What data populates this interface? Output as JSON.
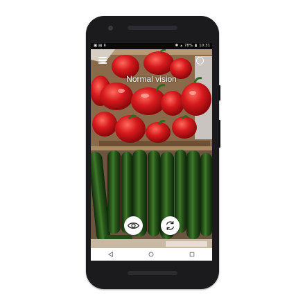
{
  "status_bar": {
    "battery": "78%",
    "time": "10:31"
  },
  "app": {
    "mode_title": "Normal vision"
  },
  "icons": {
    "menu": "hamburger-menu-icon",
    "info": "info-icon",
    "vision": "eye-icon",
    "switch_camera": "switch-camera-icon",
    "back": "triangle-back-icon",
    "home": "circle-home-icon",
    "recents": "square-recents-icon"
  },
  "colors": {
    "device": "#1b1b1d",
    "fab": "#ffffff",
    "nav_bar": "#ffffff",
    "pepper_red": "#d71a1d",
    "zucchini_green": "#1f4a17"
  }
}
